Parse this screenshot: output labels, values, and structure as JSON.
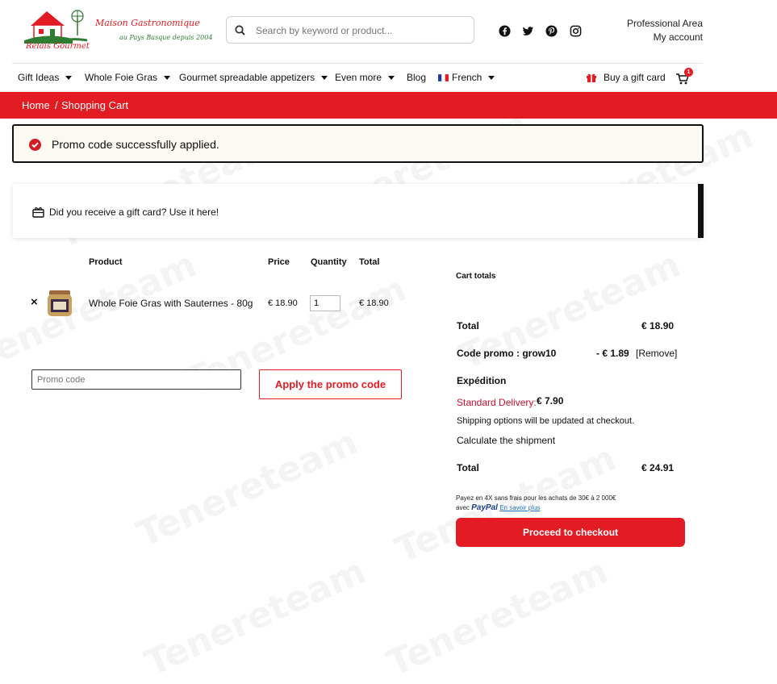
{
  "header": {
    "brand_name": "Relais Gourmet",
    "brand_tagline_1": "Maison Gastronomique",
    "brand_tagline_2": "au Pays Basque depuis 2004",
    "search_placeholder": "Search by keyword or product...",
    "professional_area": "Professional Area",
    "my_account": "My account",
    "social_icons": [
      "facebook-icon",
      "twitter-icon",
      "pinterest-icon",
      "instagram-icon"
    ]
  },
  "nav": {
    "items": [
      {
        "label": "Gift Ideas",
        "dropdown": true
      },
      {
        "label": "Whole Foie Gras",
        "dropdown": true
      },
      {
        "label": "Gourmet spreadable appetizers",
        "dropdown": true
      },
      {
        "label": "Even more",
        "dropdown": true
      },
      {
        "label": "Blog",
        "dropdown": false
      },
      {
        "label": "French",
        "dropdown": true
      }
    ],
    "gift_card": "Buy a gift card",
    "cart_count": "1"
  },
  "breadcrumb": {
    "home": "Home",
    "separator": "/",
    "current": "Shopping Cart"
  },
  "notice": {
    "message": "Promo code successfully applied."
  },
  "gift_card_box": {
    "message": "Did you receive a gift card? Use it here!"
  },
  "cart_table": {
    "headers": {
      "product": "Product",
      "price": "Price",
      "quantity": "Quantity",
      "total": "Total"
    },
    "rows": [
      {
        "remove": "×",
        "name": "Whole Foie Gras with Sauternes - 80g",
        "price": "€ 18.90",
        "quantity": "1",
        "total": "€ 18.90"
      }
    ]
  },
  "promo": {
    "placeholder": "Promo code",
    "button": "Apply the promo code"
  },
  "totals": {
    "title": "Cart totals",
    "subtotal_label": "Total",
    "subtotal_value": "€ 18.90",
    "promo_label": "Code promo : grow10",
    "promo_value": "- € 1.89",
    "promo_remove": "[Remove]",
    "shipping_label": "Expédition",
    "shipping_method": "Standard Delivery:",
    "shipping_value": "€ 7.90",
    "shipping_note": "Shipping options will be updated at checkout.",
    "calculate": "Calculate the shipment",
    "total_label": "Total",
    "total_value": "€ 24.91",
    "paypal_line1": "Payez en 4X sans frais pour les achats de 30€ à 2 000€",
    "paypal_avec": "avec",
    "paypal_brand": "PayPal",
    "paypal_link": "En savoir plus",
    "checkout": "Proceed to checkout"
  },
  "watermark": "Tenereteam",
  "colors": {
    "accent": "#e31b23",
    "notice_bg": "#fcfaf0",
    "paypal_blue": "#1a3e8c",
    "paypal_light": "#1d9bd7"
  }
}
